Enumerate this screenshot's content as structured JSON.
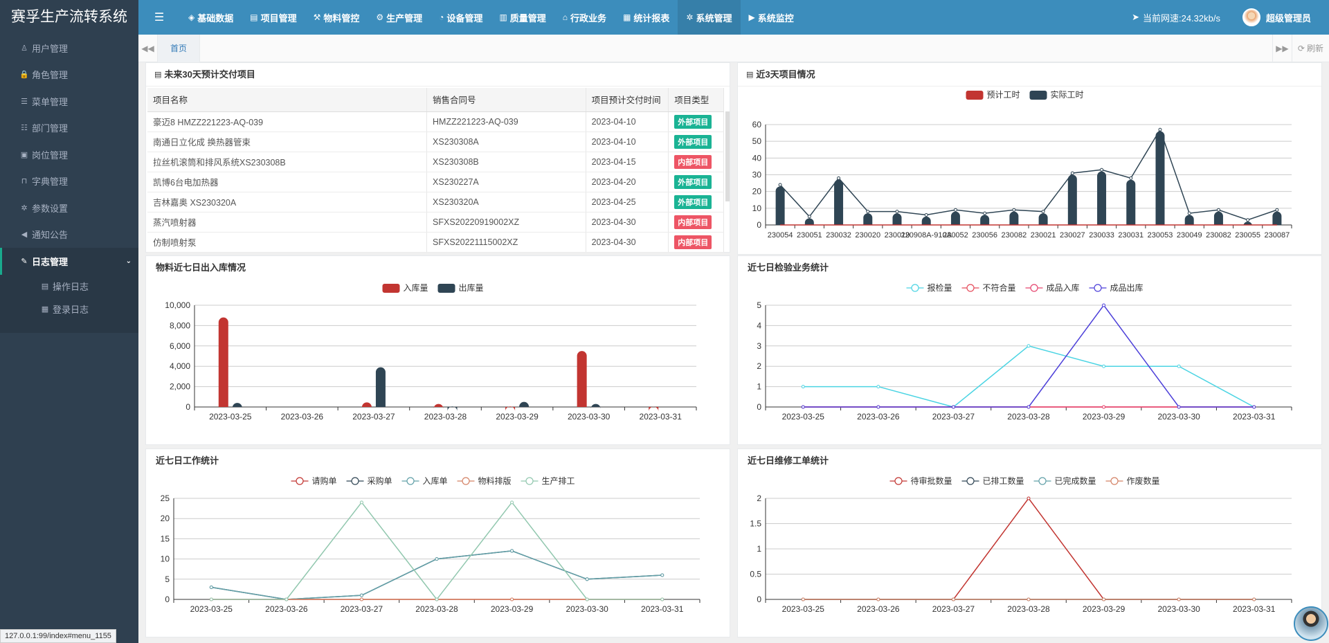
{
  "app": {
    "title": "赛孚生产流转系统",
    "status_url": "127.0.0.1:99/index#menu_1155"
  },
  "sidebar": {
    "items": [
      {
        "label": "用户管理",
        "icon": "user-icon",
        "glyph": "♙"
      },
      {
        "label": "角色管理",
        "icon": "lock-icon",
        "glyph": "🔒"
      },
      {
        "label": "菜单管理",
        "icon": "list-icon",
        "glyph": "☰"
      },
      {
        "label": "部门管理",
        "icon": "outdent-icon",
        "glyph": "☷"
      },
      {
        "label": "岗位管理",
        "icon": "id-card-icon",
        "glyph": "▣"
      },
      {
        "label": "字典管理",
        "icon": "bookmark-icon",
        "glyph": "⊓"
      },
      {
        "label": "参数设置",
        "icon": "sun-icon",
        "glyph": "✲"
      },
      {
        "label": "通知公告",
        "icon": "bullhorn-icon",
        "glyph": "◀"
      }
    ],
    "active": {
      "label": "日志管理",
      "glyph": "✎",
      "caret": "⌄"
    },
    "sub": [
      {
        "label": "操作日志",
        "glyph": "▤"
      },
      {
        "label": "登录日志",
        "glyph": "▦"
      }
    ]
  },
  "topnav": {
    "toggle": "☰",
    "items": [
      {
        "label": "基础数据",
        "glyph": "◈"
      },
      {
        "label": "项目管理",
        "glyph": "▤"
      },
      {
        "label": "物料管控",
        "glyph": "⚒"
      },
      {
        "label": "生产管理",
        "glyph": "⚙"
      },
      {
        "label": "设备管理",
        "glyph": "◔"
      },
      {
        "label": "质量管理",
        "glyph": "▥"
      },
      {
        "label": "行政业务",
        "glyph": "⌂"
      },
      {
        "label": "统计报表",
        "glyph": "▦"
      },
      {
        "label": "系统管理",
        "glyph": "✲"
      },
      {
        "label": "系统监控",
        "glyph": "▶"
      }
    ],
    "net": "当前网速:24.32kb/s",
    "net_glyph": "➤",
    "user": "超级管理员"
  },
  "tabs": {
    "home": "首页",
    "left_arrow": "◀◀",
    "right_arrow": "▶▶",
    "refresh": "刷新",
    "refresh_glyph": "⟳"
  },
  "colors": {
    "red": "#c23531",
    "navy": "#2f4554",
    "external": "#1ab394",
    "internal": "#ed5565"
  },
  "delivery": {
    "title": "未来30天预计交付项目",
    "glyph": "▤",
    "headers": [
      "项目名称",
      "销售合同号",
      "项目预计交付时间",
      "项目类型"
    ],
    "rows": [
      [
        "豪迈8 HMZZ221223-AQ-039",
        "HMZZ221223-AQ-039",
        "2023-04-10",
        "外部项目"
      ],
      [
        "南通日立化成 换热器管束",
        "XS230308A",
        "2023-04-10",
        "外部项目"
      ],
      [
        "拉丝机滚筒和排风系统XS230308B",
        "XS230308B",
        "2023-04-15",
        "内部项目"
      ],
      [
        "凯博6台电加热器",
        "XS230227A",
        "2023-04-20",
        "外部项目"
      ],
      [
        "吉林嘉奥 XS230320A",
        "XS230320A",
        "2023-04-25",
        "外部项目"
      ],
      [
        "蒸汽喷射器",
        "SFXS20220919002XZ",
        "2023-04-30",
        "内部项目"
      ],
      [
        "仿制喷射泵",
        "SFXS20221115002XZ",
        "2023-04-30",
        "内部项目"
      ]
    ]
  },
  "panels": {
    "project": "近3天项目情况",
    "material": "物料近七日出入库情况",
    "inspection": "近七日检验业务统计",
    "work": "近七日工作统计",
    "repair": "近七日维修工单统计"
  },
  "chart_data": [
    {
      "id": "project",
      "type": "bar",
      "series_type": "bar+line",
      "categories": [
        "230054",
        "230051",
        "230032",
        "230020",
        "230019",
        "220908A-910A",
        "230052",
        "230056",
        "230082",
        "230021",
        "230027",
        "230033",
        "230031",
        "230053",
        "230049",
        "230082",
        "230055",
        "230087"
      ],
      "series": [
        {
          "name": "预计工时",
          "color": "#c23531",
          "values": [
            0,
            0,
            0,
            0,
            0,
            0,
            0,
            0,
            0,
            0,
            0,
            0,
            0,
            0,
            0,
            0,
            0,
            0
          ]
        },
        {
          "name": "实际工时",
          "color": "#2f4554",
          "values": [
            23,
            4,
            27,
            7,
            7,
            5,
            8,
            6,
            8,
            7,
            30,
            32,
            27,
            56,
            6,
            8,
            2,
            8
          ]
        }
      ],
      "line_values": [
        24,
        5,
        28,
        8,
        8,
        6,
        9,
        7,
        9,
        8,
        31,
        33,
        28,
        57,
        7,
        9,
        3,
        9
      ],
      "ylim": [
        0,
        60
      ],
      "yticks": [
        0,
        10,
        20,
        30,
        40,
        50,
        60
      ],
      "legend": "top-center"
    },
    {
      "id": "material",
      "type": "bar",
      "categories": [
        "2023-03-25",
        "2023-03-26",
        "2023-03-27",
        "2023-03-28",
        "2023-03-29",
        "2023-03-30",
        "2023-03-31"
      ],
      "series": [
        {
          "name": "入库量",
          "color": "#c23531",
          "values": [
            8800,
            0,
            450,
            300,
            50,
            5500,
            20
          ]
        },
        {
          "name": "出库量",
          "color": "#2f4554",
          "values": [
            400,
            0,
            3900,
            50,
            500,
            300,
            0
          ]
        }
      ],
      "ylim": [
        0,
        10000
      ],
      "yticks": [
        "0",
        "2,000",
        "4,000",
        "6,000",
        "8,000",
        "10,000"
      ],
      "legend": "top-center"
    },
    {
      "id": "inspection",
      "type": "line",
      "categories": [
        "2023-03-25",
        "2023-03-26",
        "2023-03-27",
        "2023-03-28",
        "2023-03-29",
        "2023-03-30",
        "2023-03-31"
      ],
      "series": [
        {
          "name": "报检量",
          "color": "#4bd4e3",
          "values": [
            1,
            1,
            0,
            3,
            2,
            2,
            0
          ]
        },
        {
          "name": "不符合量",
          "color": "#e54b5a",
          "values": [
            0,
            0,
            0,
            0,
            0,
            0,
            0
          ]
        },
        {
          "name": "成品入库",
          "color": "#e5436e",
          "values": [
            0,
            0,
            0,
            0,
            0,
            0,
            0
          ]
        },
        {
          "name": "成品出库",
          "color": "#4c3fd9",
          "values": [
            0,
            0,
            0,
            0,
            5,
            0,
            0
          ]
        }
      ],
      "ylim": [
        0,
        5
      ],
      "yticks": [
        "0",
        "1",
        "2",
        "3",
        "4",
        "5"
      ],
      "legend": "top-center"
    },
    {
      "id": "work",
      "type": "line",
      "categories": [
        "2023-03-25",
        "2023-03-26",
        "2023-03-27",
        "2023-03-28",
        "2023-03-29",
        "2023-03-30",
        "2023-03-31"
      ],
      "series": [
        {
          "name": "请购单",
          "color": "#c23531",
          "values": [
            0,
            0,
            0,
            0,
            0,
            0,
            0
          ]
        },
        {
          "name": "采购单",
          "color": "#2f4554",
          "values": [
            3,
            0,
            1,
            10,
            12,
            5,
            6
          ]
        },
        {
          "name": "入库单",
          "color": "#61a0a8",
          "values": [
            3,
            0,
            1,
            10,
            12,
            5,
            6
          ]
        },
        {
          "name": "物料排版",
          "color": "#d48265",
          "values": [
            0,
            0,
            0,
            0,
            0,
            0,
            0
          ]
        },
        {
          "name": "生产排工",
          "color": "#91c7ae",
          "values": [
            0,
            0,
            24,
            0,
            24,
            0,
            0
          ]
        }
      ],
      "ylim": [
        0,
        25
      ],
      "yticks": [
        "0",
        "5",
        "10",
        "15",
        "20",
        "25"
      ],
      "legend": "top-center"
    },
    {
      "id": "repair",
      "type": "line",
      "categories": [
        "2023-03-25",
        "2023-03-26",
        "2023-03-27",
        "2023-03-28",
        "2023-03-29",
        "2023-03-30",
        "2023-03-31"
      ],
      "series": [
        {
          "name": "待审批数量",
          "color": "#c23531",
          "values": [
            0,
            0,
            0,
            2,
            0,
            0,
            0
          ]
        },
        {
          "name": "已排工数量",
          "color": "#2f4554",
          "values": [
            0,
            0,
            0,
            0,
            0,
            0,
            0
          ]
        },
        {
          "name": "已完成数量",
          "color": "#61a0a8",
          "values": [
            0,
            0,
            0,
            0,
            0,
            0,
            0
          ]
        },
        {
          "name": "作废数量",
          "color": "#d48265",
          "values": [
            0,
            0,
            0,
            0,
            0,
            0,
            0
          ]
        }
      ],
      "ylim": [
        0,
        2
      ],
      "yticks": [
        "0",
        "0.5",
        "1",
        "1.5",
        "2"
      ],
      "legend": "top-center"
    }
  ]
}
